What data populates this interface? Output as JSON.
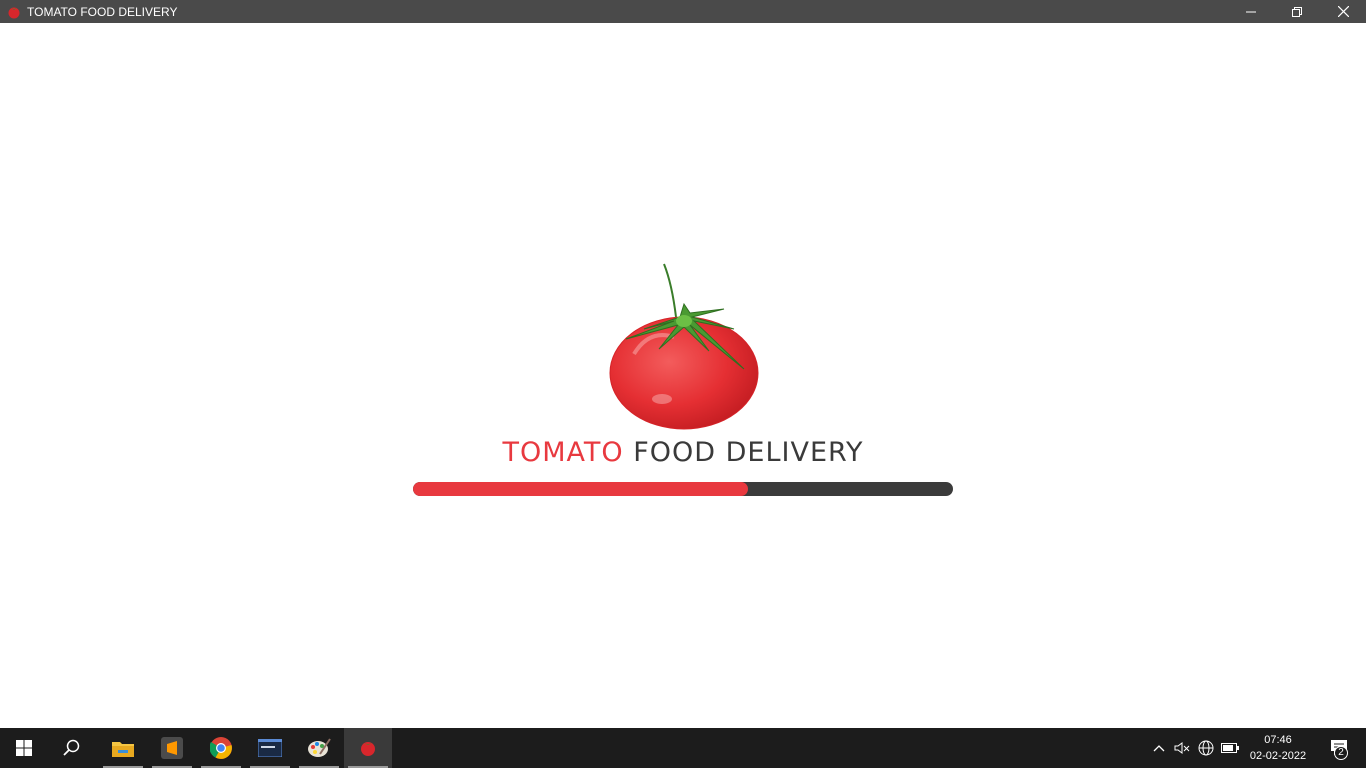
{
  "window": {
    "title": "TOMATO FOOD DELIVERY"
  },
  "splash": {
    "brand_primary": "TOMATO",
    "brand_secondary": "FOOD DELIVERY",
    "progress_fraction": 0.62,
    "accent_color": "#e8393f",
    "dark_color": "#3a3a3a"
  },
  "taskbar": {
    "apps": [
      "start-icon",
      "search-icon",
      "file-explorer-icon",
      "sublime-text-icon",
      "chrome-icon",
      "mysql-terminal-icon",
      "paint-icon",
      "tomato-app-icon"
    ],
    "notification_count": "2",
    "time": "07:46",
    "date": "02-02-2022"
  }
}
